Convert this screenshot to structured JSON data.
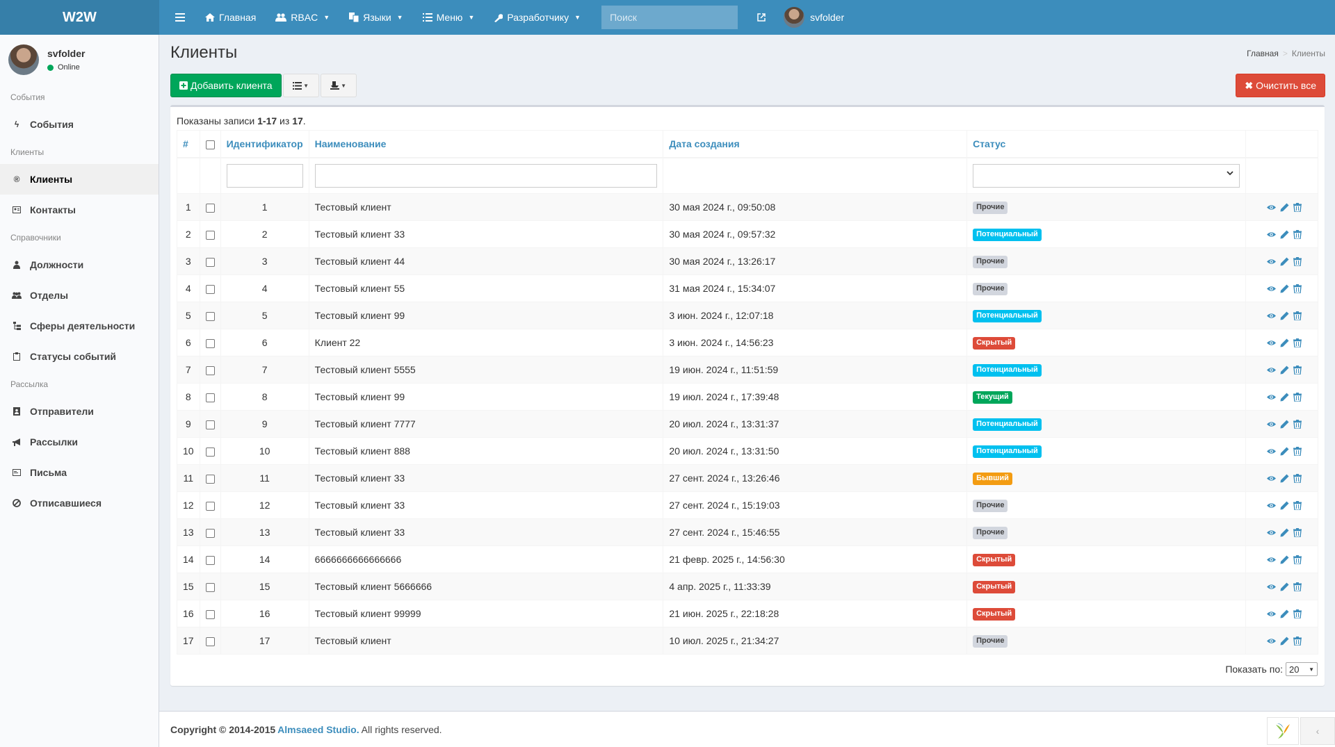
{
  "header": {
    "logo": "W2W",
    "nav": [
      {
        "label": "Главная",
        "icon": "home-icon"
      },
      {
        "label": "RBAC",
        "icon": "users-icon",
        "dropdown": true
      },
      {
        "label": "Языки",
        "icon": "translate-icon",
        "dropdown": true
      },
      {
        "label": "Меню",
        "icon": "list-icon",
        "dropdown": true
      },
      {
        "label": "Разработчику",
        "icon": "wrench-icon",
        "dropdown": true
      }
    ],
    "search_placeholder": "Поиск",
    "username": "svfolder"
  },
  "sidebar": {
    "username": "svfolder",
    "status": "Online",
    "sections": [
      {
        "header": "События",
        "items": [
          {
            "label": "События",
            "icon": "bolt-icon"
          }
        ]
      },
      {
        "header": "Клиенты",
        "items": [
          {
            "label": "Клиенты",
            "icon": "registered-icon",
            "active": true
          },
          {
            "label": "Контакты",
            "icon": "contact-card-icon"
          }
        ]
      },
      {
        "header": "Справочники",
        "items": [
          {
            "label": "Должности",
            "icon": "user-tie-icon"
          },
          {
            "label": "Отделы",
            "icon": "group-icon"
          },
          {
            "label": "Сферы деятельности",
            "icon": "sitemap-icon"
          },
          {
            "label": "Статусы событий",
            "icon": "clipboard-icon"
          }
        ]
      },
      {
        "header": "Рассылка",
        "items": [
          {
            "label": "Отправители",
            "icon": "address-book-icon"
          },
          {
            "label": "Рассылки",
            "icon": "bullhorn-icon"
          },
          {
            "label": "Письма",
            "icon": "envelope-icon"
          },
          {
            "label": "Отписавшиеся",
            "icon": "ban-icon"
          }
        ]
      }
    ]
  },
  "page": {
    "title": "Клиенты",
    "breadcrumb": [
      "Главная",
      "Клиенты"
    ],
    "add_button": "Добавить клиента",
    "clear_button": "Очистить все",
    "summary_prefix": "Показаны записи ",
    "summary_range": "1-17",
    "summary_mid": " из ",
    "summary_total": "17",
    "summary_end": ".",
    "per_page_label": "Показать по:",
    "per_page_value": "20"
  },
  "table": {
    "columns": [
      "#",
      "",
      "Идентификатор",
      "Наименование",
      "Дата создания",
      "Статус",
      ""
    ],
    "rows": [
      {
        "n": "1",
        "id": "1",
        "name": "Тестовый клиент",
        "date": "30 мая 2024 г., 09:50:08",
        "status": "Прочие",
        "kind": "other"
      },
      {
        "n": "2",
        "id": "2",
        "name": "Тестовый клиент 33",
        "date": "30 мая 2024 г., 09:57:32",
        "status": "Потенциальный",
        "kind": "pot"
      },
      {
        "n": "3",
        "id": "3",
        "name": "Тестовый клиент 44",
        "date": "30 мая 2024 г., 13:26:17",
        "status": "Прочие",
        "kind": "other"
      },
      {
        "n": "4",
        "id": "4",
        "name": "Тестовый клиент 55",
        "date": "31 мая 2024 г., 15:34:07",
        "status": "Прочие",
        "kind": "other"
      },
      {
        "n": "5",
        "id": "5",
        "name": "Тестовый клиент 99",
        "date": "3 июн. 2024 г., 12:07:18",
        "status": "Потенциальный",
        "kind": "pot"
      },
      {
        "n": "6",
        "id": "6",
        "name": "Клиент 22",
        "date": "3 июн. 2024 г., 14:56:23",
        "status": "Скрытый",
        "kind": "hid"
      },
      {
        "n": "7",
        "id": "7",
        "name": "Тестовый клиент 5555",
        "date": "19 июн. 2024 г., 11:51:59",
        "status": "Потенциальный",
        "kind": "pot"
      },
      {
        "n": "8",
        "id": "8",
        "name": "Тестовый клиент 99",
        "date": "19 июл. 2024 г., 17:39:48",
        "status": "Текущий",
        "kind": "cur"
      },
      {
        "n": "9",
        "id": "9",
        "name": "Тестовый клиент 7777",
        "date": "20 июл. 2024 г., 13:31:37",
        "status": "Потенциальный",
        "kind": "pot"
      },
      {
        "n": "10",
        "id": "10",
        "name": "Тестовый клиент 888",
        "date": "20 июл. 2024 г., 13:31:50",
        "status": "Потенциальный",
        "kind": "pot"
      },
      {
        "n": "11",
        "id": "11",
        "name": "Тестовый клиент 33",
        "date": "27 сент. 2024 г., 13:26:46",
        "status": "Бывший",
        "kind": "ex"
      },
      {
        "n": "12",
        "id": "12",
        "name": "Тестовый клиент 33",
        "date": "27 сент. 2024 г., 15:19:03",
        "status": "Прочие",
        "kind": "other"
      },
      {
        "n": "13",
        "id": "13",
        "name": "Тестовый клиент 33",
        "date": "27 сент. 2024 г., 15:46:55",
        "status": "Прочие",
        "kind": "other"
      },
      {
        "n": "14",
        "id": "14",
        "name": "6666666666666666",
        "date": "21 февр. 2025 г., 14:56:30",
        "status": "Скрытый",
        "kind": "hid"
      },
      {
        "n": "15",
        "id": "15",
        "name": "Тестовый клиент 5666666",
        "date": "4 апр. 2025 г., 11:33:39",
        "status": "Скрытый",
        "kind": "hid"
      },
      {
        "n": "16",
        "id": "16",
        "name": "Тестовый клиент 99999",
        "date": "21 июн. 2025 г., 22:18:28",
        "status": "Скрытый",
        "kind": "hid"
      },
      {
        "n": "17",
        "id": "17",
        "name": "Тестовый клиент",
        "date": "10 июл. 2025 г., 21:34:27",
        "status": "Прочие",
        "kind": "other"
      }
    ]
  },
  "footer": {
    "prefix": "Copyright © 2014-2015",
    "company": "Almsaeed Studio.",
    "suffix": "All rights reserved."
  },
  "colors": {
    "header": "#3c8dbc",
    "success": "#00a65a",
    "danger": "#dd4b39",
    "info": "#00c0ef",
    "warning": "#f39c12"
  }
}
